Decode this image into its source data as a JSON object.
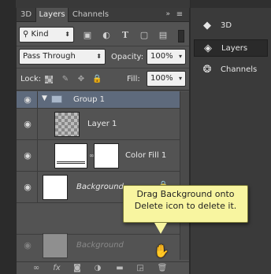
{
  "tabs": [
    {
      "label": "3D",
      "active": false
    },
    {
      "label": "Layers",
      "active": true
    },
    {
      "label": "Channels",
      "active": false
    }
  ],
  "tab_controls": {
    "collapse": "»",
    "menu": "≡"
  },
  "filter": {
    "kind_label": "Kind"
  },
  "blend": {
    "mode": "Pass Through",
    "opacity_label": "Opacity:",
    "opacity_value": "100%"
  },
  "lock": {
    "label": "Lock:",
    "fill_label": "Fill:",
    "fill_value": "100%"
  },
  "layers": [
    {
      "name": "Group 1",
      "type": "group",
      "visible": true
    },
    {
      "name": "Layer 1",
      "type": "pixel",
      "visible": true
    },
    {
      "name": "Color Fill 1",
      "type": "fill",
      "visible": true
    },
    {
      "name": "Background",
      "type": "background",
      "visible": true
    },
    {
      "name": "Background",
      "type": "background-dragging",
      "visible": true
    }
  ],
  "tooltip": {
    "text": "Drag Background onto Delete icon to delete it."
  },
  "right_panel": [
    {
      "label": "3D",
      "icon": "cube-icon",
      "active": false
    },
    {
      "label": "Layers",
      "icon": "layers-icon",
      "active": true
    },
    {
      "label": "Channels",
      "icon": "channels-icon",
      "active": false
    }
  ],
  "colors": {
    "panel": "#535353",
    "group_highlight": "#5e6a7c",
    "tooltip": "#f8f5a0"
  }
}
